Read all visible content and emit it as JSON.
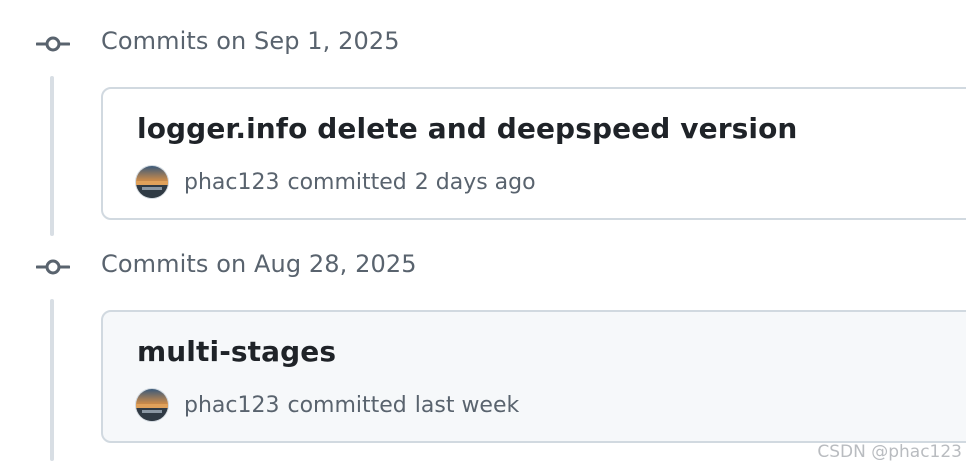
{
  "groups": [
    {
      "title": "Commits on Sep 1, 2025",
      "commit": {
        "message": "logger.info delete and deepspeed version",
        "author": "phac123",
        "action": "committed",
        "time": "2 days ago"
      }
    },
    {
      "title": "Commits on Aug 28, 2025",
      "commit": {
        "message": "multi-stages",
        "author": "phac123",
        "action": "committed",
        "time": "last week"
      }
    }
  ],
  "icons": {
    "commit": "git-commit-icon",
    "avatar": "avatar-image"
  },
  "colors": {
    "timeline_line": "#d8dee4",
    "card_border": "#d1d9e0",
    "card_hover_bg": "#f6f8fa",
    "muted_text": "#59636e"
  },
  "watermark": "CSDN @phac123"
}
